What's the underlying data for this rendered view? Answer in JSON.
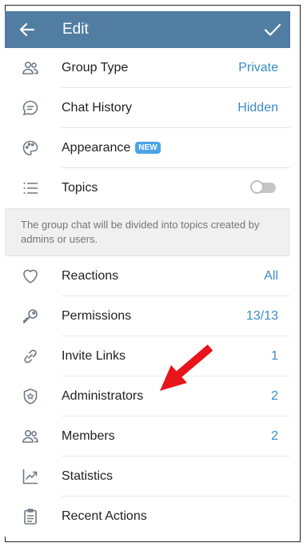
{
  "header": {
    "title": "Edit",
    "bg_color": "#527da3"
  },
  "rows_top": [
    {
      "id": "group-type",
      "icon": "group-icon",
      "label": "Group Type",
      "value": "Private"
    },
    {
      "id": "chat-history",
      "icon": "chat-bubble-icon",
      "label": "Chat History",
      "value": "Hidden"
    },
    {
      "id": "appearance",
      "icon": "palette-icon",
      "label": "Appearance",
      "badge": "NEW"
    },
    {
      "id": "topics",
      "icon": "list-icon",
      "label": "Topics",
      "toggle": "off"
    }
  ],
  "topics_info": "The group chat will be divided into topics created by admins or users.",
  "rows_bottom": [
    {
      "id": "reactions",
      "icon": "heart-icon",
      "label": "Reactions",
      "value": "All"
    },
    {
      "id": "permissions",
      "icon": "key-icon",
      "label": "Permissions",
      "value": "13/13"
    },
    {
      "id": "invite-links",
      "icon": "link-icon",
      "label": "Invite Links",
      "value": "1"
    },
    {
      "id": "administrators",
      "icon": "shield-star-icon",
      "label": "Administrators",
      "value": "2"
    },
    {
      "id": "members",
      "icon": "group-icon",
      "label": "Members",
      "value": "2"
    },
    {
      "id": "statistics",
      "icon": "chart-icon",
      "label": "Statistics"
    },
    {
      "id": "recent-actions",
      "icon": "clipboard-icon",
      "label": "Recent Actions"
    }
  ],
  "accent_color": "#3a8cc8",
  "annotation": {
    "icon": "red-arrow-icon",
    "color": "#e8141b"
  }
}
